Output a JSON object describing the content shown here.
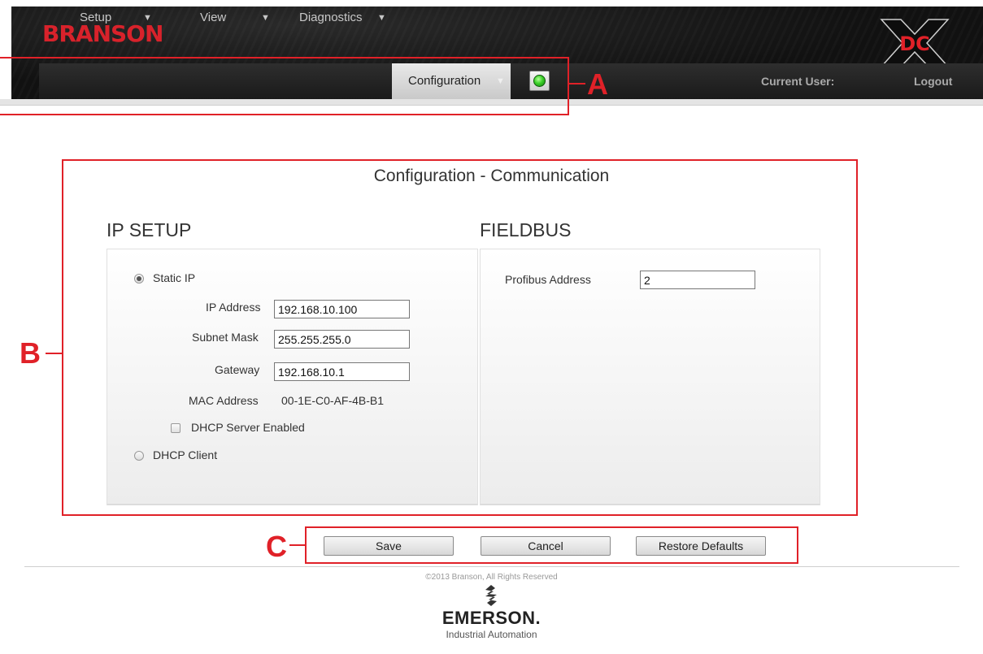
{
  "header": {
    "brand": "BRANSON",
    "logo_alt": "DC",
    "current_user_label": "Current User:",
    "logout_label": "Logout"
  },
  "nav": {
    "items": [
      {
        "label": "Setup",
        "has_dropdown": true,
        "active": false
      },
      {
        "label": "View",
        "has_dropdown": true,
        "active": false
      },
      {
        "label": "Diagnostics",
        "has_dropdown": true,
        "active": false
      },
      {
        "label": "Configuration",
        "has_dropdown": true,
        "active": true
      }
    ],
    "status_indicator": {
      "state": "ok",
      "color": "#3cd12a"
    }
  },
  "page": {
    "title": "Configuration - Communication"
  },
  "ip_setup": {
    "title": "IP SETUP",
    "static_ip_label": "Static IP",
    "static_ip_selected": true,
    "ip_address_label": "IP Address",
    "ip_address": "192.168.10.100",
    "subnet_mask_label": "Subnet Mask",
    "subnet_mask": "255.255.255.0",
    "gateway_label": "Gateway",
    "gateway": "192.168.10.1",
    "mac_address_label": "MAC Address",
    "mac_address": "00-1E-C0-AF-4B-B1",
    "dhcp_server_label": "DHCP Server Enabled",
    "dhcp_server_enabled": false,
    "dhcp_client_label": "DHCP Client",
    "dhcp_client_selected": false
  },
  "fieldbus": {
    "title": "FIELDBUS",
    "profibus_address_label": "Profibus Address",
    "profibus_address": "2"
  },
  "actions": {
    "save_label": "Save",
    "cancel_label": "Cancel",
    "restore_defaults_label": "Restore Defaults"
  },
  "footer": {
    "copyright": "©2013 Branson, All Rights Reserved",
    "company": "EMERSON.",
    "company_sub": "Industrial Automation"
  },
  "annotations": {
    "a": "A",
    "b": "B",
    "c": "C",
    "color": "#e02128"
  }
}
